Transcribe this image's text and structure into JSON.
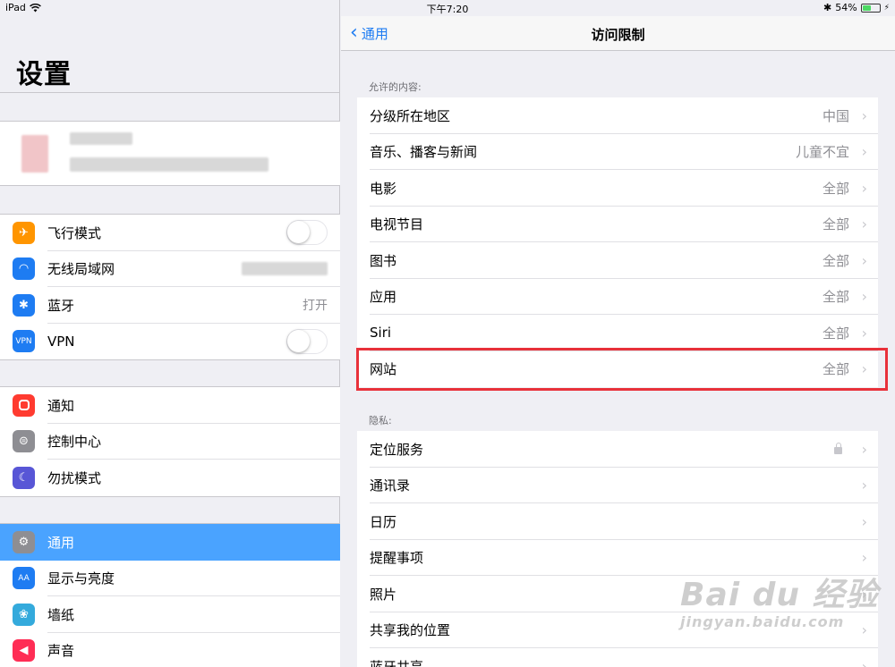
{
  "status_bar": {
    "device": "iPad",
    "time": "下午7:20",
    "battery": "54%",
    "battery_level": 0.54
  },
  "master": {
    "title": "设置",
    "group1": [
      {
        "label": "飞行模式",
        "icon": "airplane-icon",
        "color": "#ff9500",
        "control": "toggle",
        "on": false
      },
      {
        "label": "无线局域网",
        "icon": "wifi-icon",
        "color": "#1e7cf2",
        "control": "blurred"
      },
      {
        "label": "蓝牙",
        "icon": "bluetooth-icon",
        "color": "#1e7cf2",
        "value": "打开"
      },
      {
        "label": "VPN",
        "icon": "vpn-icon",
        "color": "#1e7cf2",
        "icon_text": "VPN",
        "control": "toggle",
        "on": false
      }
    ],
    "group2": [
      {
        "label": "通知",
        "icon": "notification-icon",
        "color": "#ff3b30"
      },
      {
        "label": "控制中心",
        "icon": "control-center-icon",
        "color": "#8e8e93"
      },
      {
        "label": "勿扰模式",
        "icon": "moon-icon",
        "color": "#5856d6"
      }
    ],
    "group3": [
      {
        "label": "通用",
        "icon": "gear-icon",
        "color": "#8e8e93",
        "selected": true
      },
      {
        "label": "显示与亮度",
        "icon": "text-size-icon",
        "color": "#1e7cf2",
        "icon_text": "AA"
      },
      {
        "label": "墙纸",
        "icon": "wallpaper-icon",
        "color": "#34aadc"
      },
      {
        "label": "声音",
        "icon": "speaker-icon",
        "color": "#ff2d55"
      }
    ]
  },
  "detail": {
    "back_label": "通用",
    "title": "访问限制",
    "allowed_header": "允许的内容:",
    "allowed": [
      {
        "label": "分级所在地区",
        "value": "中国"
      },
      {
        "label": "音乐、播客与新闻",
        "value": "儿童不宜"
      },
      {
        "label": "电影",
        "value": "全部"
      },
      {
        "label": "电视节目",
        "value": "全部"
      },
      {
        "label": "图书",
        "value": "全部"
      },
      {
        "label": "应用",
        "value": "全部"
      },
      {
        "label": "Siri",
        "value": "全部"
      },
      {
        "label": "网站",
        "value": "全部"
      }
    ],
    "privacy_header": "隐私:",
    "privacy": [
      {
        "label": "定位服务",
        "locked": true
      },
      {
        "label": "通讯录"
      },
      {
        "label": "日历"
      },
      {
        "label": "提醒事项"
      },
      {
        "label": "照片"
      },
      {
        "label": "共享我的位置"
      },
      {
        "label": "蓝牙共享"
      }
    ]
  },
  "watermark": {
    "main": "Bai du 经验",
    "sub": "jingyan.baidu.com"
  }
}
